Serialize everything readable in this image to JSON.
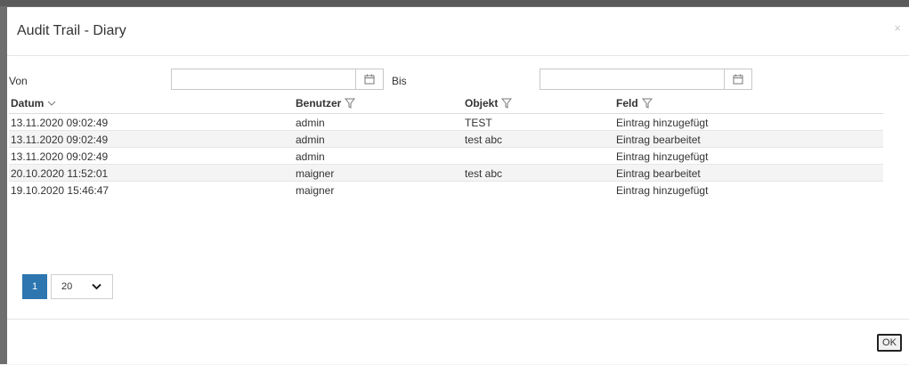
{
  "dialog": {
    "title": "Audit Trail - Diary",
    "close_glyph": "×"
  },
  "filters": {
    "from_label": "Von",
    "from_value": "",
    "to_label": "Bis",
    "to_value": ""
  },
  "table": {
    "columns": [
      {
        "label": "Datum",
        "icon": "sort-down-icon"
      },
      {
        "label": "Benutzer",
        "icon": "filter-icon"
      },
      {
        "label": "Objekt",
        "icon": "filter-icon"
      },
      {
        "label": "Feld",
        "icon": "filter-icon"
      }
    ],
    "rows": [
      [
        "13.11.2020 09:02:49",
        "admin",
        "TEST",
        "Eintrag hinzugefügt"
      ],
      [
        "13.11.2020 09:02:49",
        "admin",
        "test abc",
        "Eintrag bearbeitet"
      ],
      [
        "13.11.2020 09:02:49",
        "admin",
        "",
        "Eintrag hinzugefügt"
      ],
      [
        "20.10.2020 11:52:01",
        "maigner",
        "test abc",
        "Eintrag bearbeitet"
      ],
      [
        "19.10.2020 15:46:47",
        "maigner",
        "",
        "Eintrag hinzugefügt"
      ]
    ]
  },
  "pagination": {
    "current_page": "1",
    "page_size": "20"
  },
  "footer": {
    "ok_label": "OK"
  },
  "colors": {
    "accent": "#2d76b0",
    "backdrop": "#6e6e6e"
  }
}
